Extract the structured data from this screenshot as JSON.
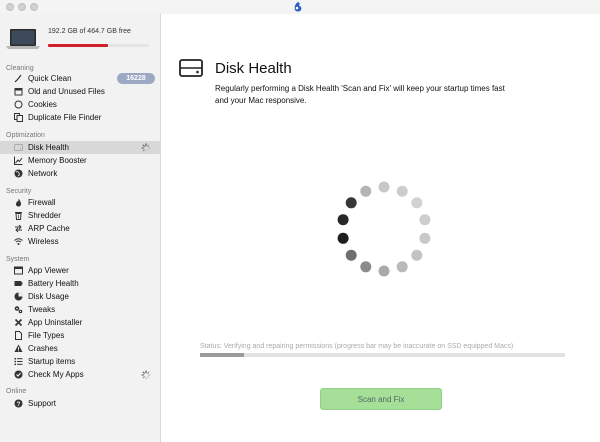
{
  "disk": {
    "text": "192.2 GB of 464.7 GB free",
    "used_fraction": 0.59
  },
  "sidebar": {
    "sections": {
      "cleaning": "Cleaning",
      "optimization": "Optimization",
      "security": "Security",
      "system": "System",
      "online": "Online"
    },
    "items": {
      "quick_clean": "Quick Clean",
      "quick_clean_badge": "16228",
      "old_files": "Old and Unused Files",
      "cookies": "Cookies",
      "duplicate": "Duplicate File Finder",
      "disk_health": "Disk Health",
      "memory": "Memory Booster",
      "network": "Network",
      "firewall": "Firewall",
      "shredder": "Shredder",
      "arp": "ARP Cache",
      "wireless": "Wireless",
      "app_viewer": "App Viewer",
      "battery": "Battery Health",
      "disk_usage": "Disk Usage",
      "tweaks": "Tweaks",
      "uninstaller": "App Uninstaller",
      "file_types": "File Types",
      "crashes": "Crashes",
      "startup": "Startup items",
      "check_apps": "Check My Apps",
      "support": "Support"
    },
    "selected": "disk_health"
  },
  "main": {
    "title": "Disk Health",
    "description": "Regularly performing a Disk Health 'Scan and Fix' will keep your startup times fast and your Mac responsive.",
    "status": "Status: Verifying and repairing permissions (progress bar may be inaccurate on SSD equipped Macs)",
    "progress_fraction": 0.12,
    "button": "Scan and Fix"
  },
  "colors": {
    "disk_bar": "#d0202a",
    "button": "#a5df98",
    "badge": "#9da8c5"
  }
}
